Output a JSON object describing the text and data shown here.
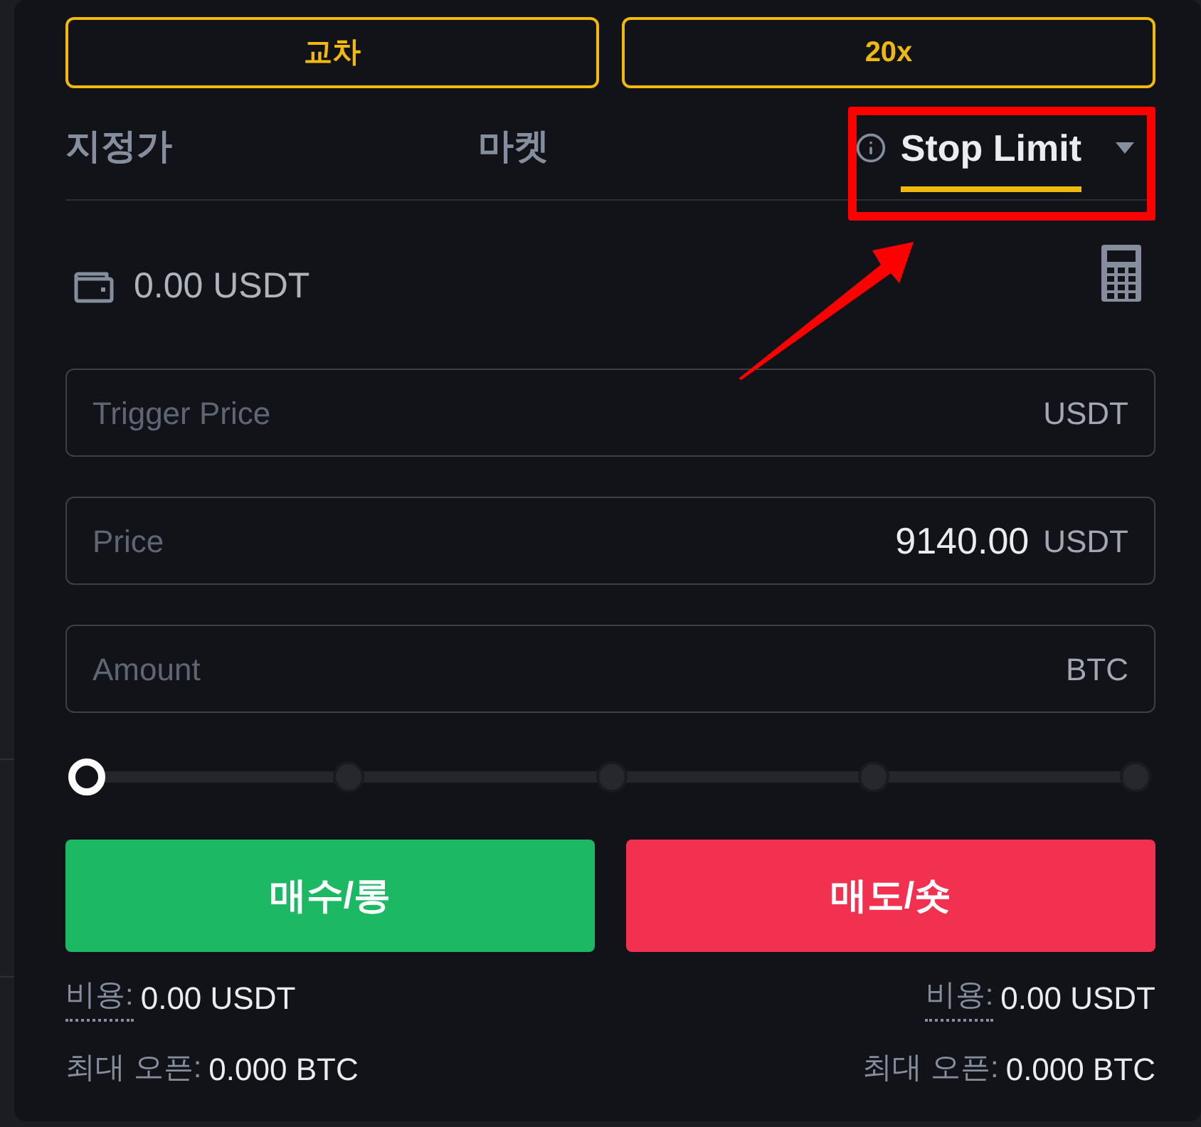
{
  "margin_buttons": [
    {
      "label": "교차"
    },
    {
      "label": "20x"
    }
  ],
  "order_tabs": [
    {
      "label": "지정가",
      "selected": false,
      "kind": "plain",
      "highlighted": false
    },
    {
      "label": "마켓",
      "selected": false,
      "kind": "plain",
      "highlighted": false
    },
    {
      "label": "Stop Limit",
      "selected": true,
      "kind": "dropdown",
      "highlighted": true
    }
  ],
  "balance": {
    "value": "0.00 USDT"
  },
  "fields": [
    {
      "label": "Trigger Price",
      "unit": "USDT"
    },
    {
      "label": "Price",
      "value": "9140.00",
      "unit": "USDT"
    },
    {
      "label": "Amount",
      "unit": "BTC"
    }
  ],
  "amount_slider": {
    "level": 0
  },
  "actions": [
    {
      "label": "매수/롱",
      "kind": "buy"
    },
    {
      "label": "매도/숏",
      "kind": "sell"
    }
  ],
  "summaries": [
    {
      "rows": [
        {
          "label": "비용:",
          "value": "0.00 USDT",
          "underlined": true
        },
        {
          "label": "최대 오픈:",
          "value": "0.000 BTC",
          "underlined": false
        }
      ]
    },
    {
      "rows": [
        {
          "label": "비용:",
          "value": "0.00 USDT",
          "underlined": true
        },
        {
          "label": "최대 오픈:",
          "value": "0.000 BTC",
          "underlined": false
        }
      ]
    }
  ]
}
